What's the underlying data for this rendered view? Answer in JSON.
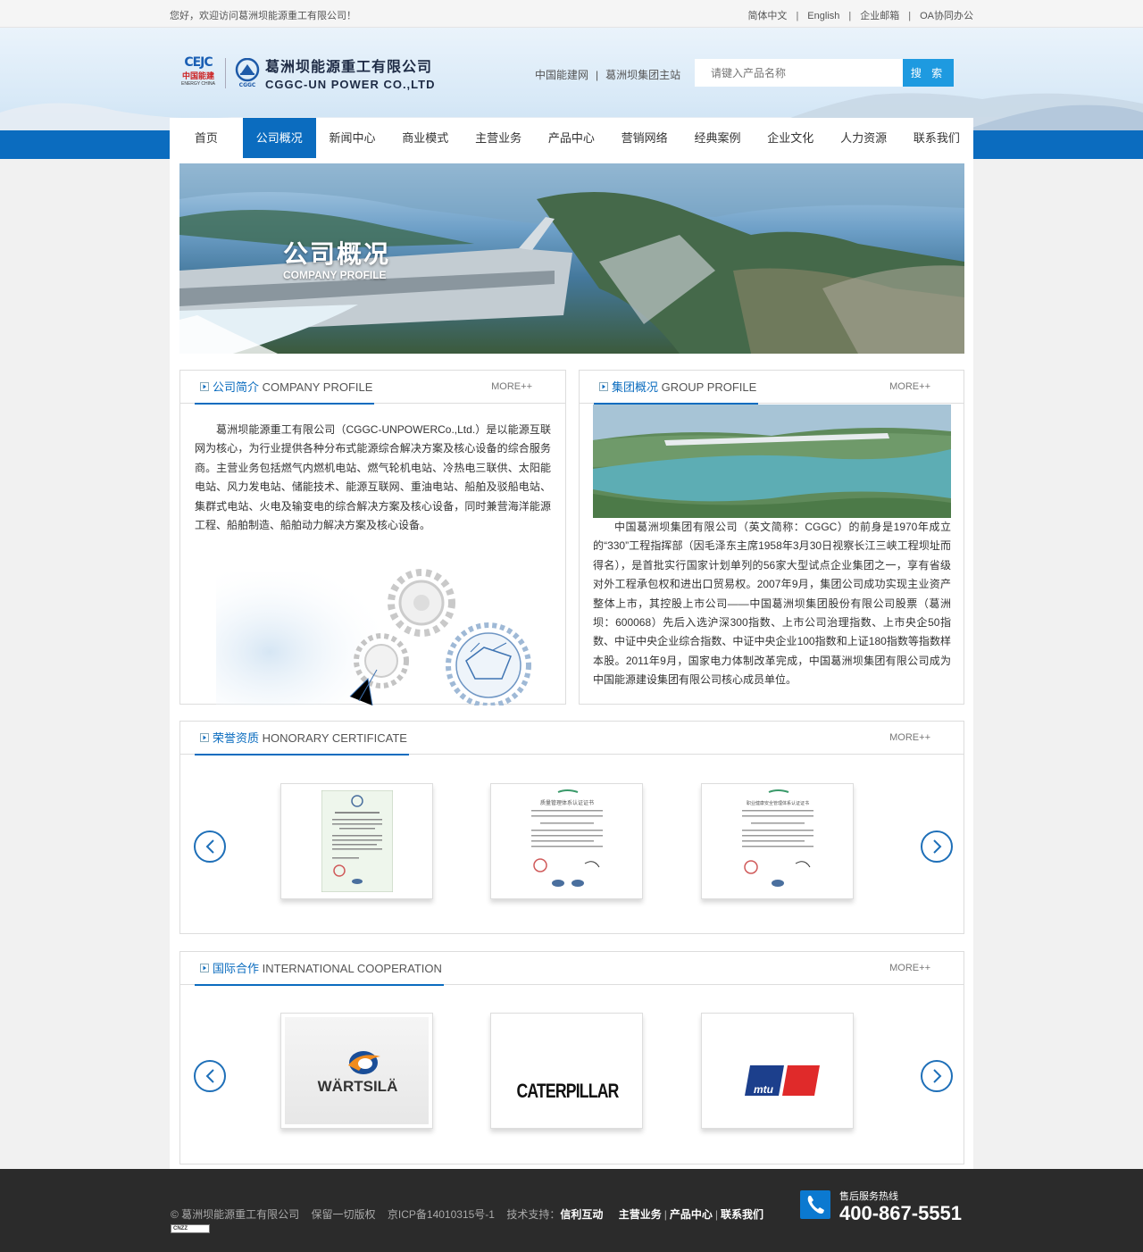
{
  "topbar": {
    "welcome": "您好，欢迎访问葛洲坝能源重工有限公司！",
    "links": [
      "简体中文",
      "English",
      "企业邮箱",
      "OA协同办公"
    ],
    "sep": "|"
  },
  "header": {
    "logo_cejc": "CEJC",
    "logo_cejc_cn": "中国能建",
    "logo_cejc_en": "ENERGY CHINA",
    "logo_cggc": "CGGC",
    "company_cn": "葛洲坝能源重工有限公司",
    "company_en": "CGGC-UN POWER CO.,LTD",
    "links": [
      "中国能建网",
      "葛洲坝集团主站"
    ],
    "sep": "|",
    "search_placeholder": "请键入产品名称",
    "search_button": "搜 索"
  },
  "nav": {
    "items": [
      "首页",
      "公司概况",
      "新闻中心",
      "商业模式",
      "主营业务",
      "产品中心",
      "营销网络",
      "经典案例",
      "企业文化",
      "人力资源",
      "联系我们"
    ],
    "active_index": 1
  },
  "banner": {
    "title": "公司概况",
    "subtitle": "COMPANY PROFILE"
  },
  "company_profile": {
    "title_cn": "公司简介",
    "title_en": "COMPANY PROFILE",
    "more": "MORE++",
    "text": "葛洲坝能源重工有限公司（CGGC-UNPOWERCo.,Ltd.）是以能源互联网为核心，为行业提供各种分布式能源综合解决方案及核心设备的综合服务商。主营业务包括燃气内燃机电站、燃气轮机电站、冷热电三联供、太阳能电站、风力发电站、储能技术、能源互联网、重油电站、船舶及驳船电站、集群式电站、火电及输变电的综合解决方案及核心设备，同时兼营海洋能源工程、船舶制造、船舶动力解决方案及核心设备。"
  },
  "group_profile": {
    "title_cn": "集团概况",
    "title_en": "GROUP PROFILE",
    "more": "MORE++",
    "text": "中国葛洲坝集团有限公司（英文简称：CGGC）的前身是1970年成立的“330”工程指挥部（因毛泽东主席1958年3月30日视察长江三峡工程坝址而得名），是首批实行国家计划单列的56家大型试点企业集团之一，享有省级对外工程承包权和进出口贸易权。2007年9月，集团公司成功实现主业资产整体上市，其控股上市公司——中国葛洲坝集团股份有限公司股票（葛洲坝：600068）先后入选沪深300指数、上市公司治理指数、上市央企50指数、中证中央企业综合指数、中证中央企业100指数和上证180指数等指数样本股。2011年9月，国家电力体制改革完成，中国葛洲坝集团有限公司成为中国能源建设集团有限公司核心成员单位。"
  },
  "honors": {
    "title_cn": "荣誉资质",
    "title_en": "HONORARY CERTIFICATE",
    "more": "MORE++",
    "cert_headers": [
      "质量管理体系认证证书",
      "职业健康安全管理体系认证证书"
    ]
  },
  "intl": {
    "title_cn": "国际合作",
    "title_en": "INTERNATIONAL COOPERATION",
    "more": "MORE++",
    "partners": [
      "WÄRTSILÄ",
      "CATERPILLAR",
      "mtu"
    ]
  },
  "footer": {
    "copyright": "© 葛洲坝能源重工有限公司",
    "rights": "保留一切版权",
    "icp": "京ICP备14010315号-1",
    "support_label": "技术支持：",
    "support_name": "信利互动",
    "links": [
      "主营业务",
      "产品中心",
      "联系我们"
    ],
    "sep": "|",
    "hotline_label": "售后服务热线",
    "hotline": "400-867-5551",
    "cnzz": "CNZZ"
  },
  "colors": {
    "brand_blue": "#0b6cbf",
    "search_button": "#1e9ae0",
    "footer_bg": "#2b2b2b"
  }
}
